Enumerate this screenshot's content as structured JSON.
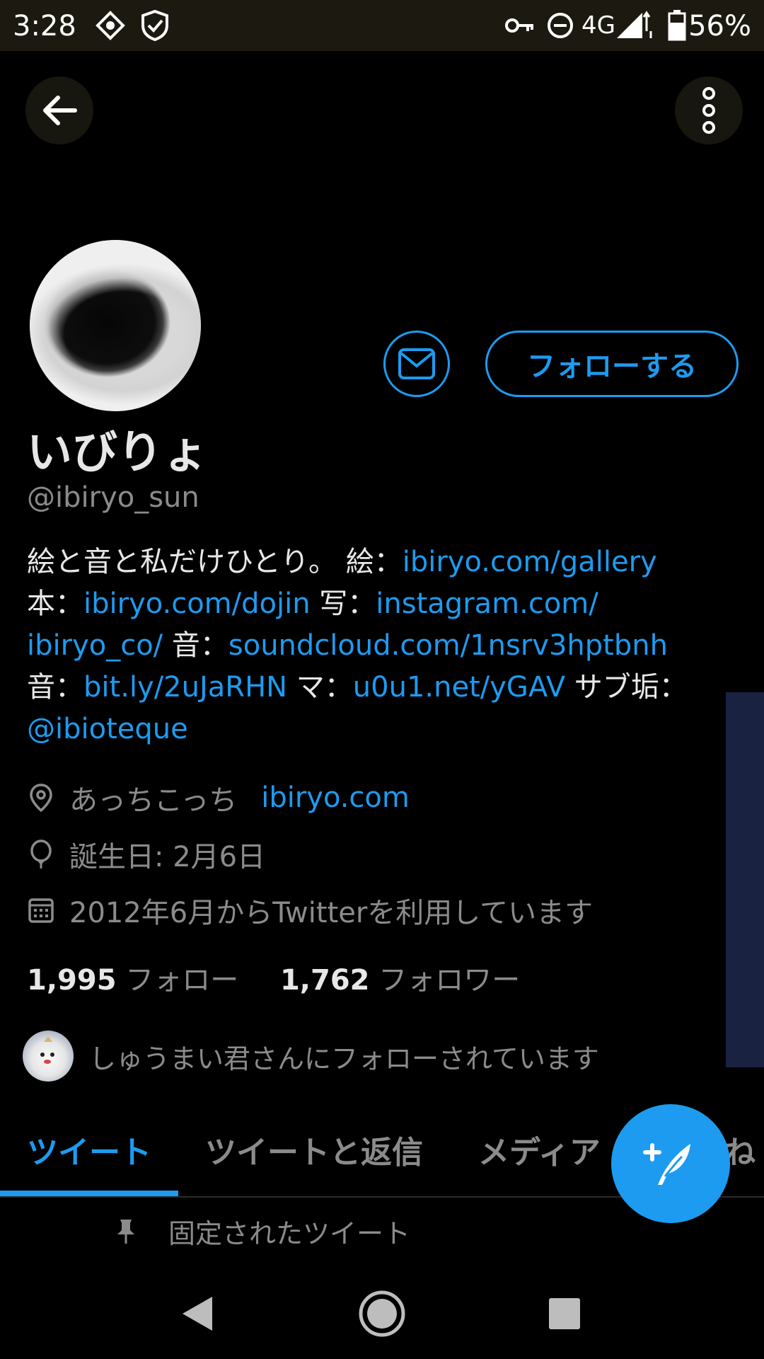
{
  "status_bar": {
    "time": "3:28",
    "network": "4G",
    "battery": "56%",
    "icons": [
      "location-diamond-icon",
      "shield-check-icon",
      "key-icon",
      "do-not-disturb-icon",
      "signal-icon",
      "battery-icon"
    ]
  },
  "header": {
    "back_icon": "arrow-left-icon",
    "menu_icon": "more-vertical-icon"
  },
  "profile": {
    "name": "いびりょ",
    "handle": "@ibiryo_sun",
    "follow_label": "フォローする",
    "dm_icon": "mail-icon"
  },
  "bio": {
    "line1_text": "絵と音と私だけひとり。 絵：",
    "line1_link": "ibiryo.com/gallery",
    "line2_prefix": "本：",
    "line2_link": "ibiryo.com/dojin",
    "line2_mid": " 写：",
    "line2_link2": "instagram.com/",
    "line3_link": "ibiryo_co/",
    "line3_mid": " 音：",
    "line3_link2": "soundcloud.com/1nsrv3hptbnh",
    "line4_prefix": "音：",
    "line4_link": "bit.ly/2uJaRHN",
    "line4_mid": " マ：",
    "line4_link2": "u0u1.net/yGAV",
    "line4_suffix": " サブ垢：",
    "line5_link": "@ibioteque"
  },
  "meta": {
    "location": "あっちこっち",
    "website": "ibiryo.com",
    "birthday": "誕生日: 2月6日",
    "joined": "2012年6月からTwitterを利用しています"
  },
  "counts": {
    "following_count": "1,995",
    "following_label": "フォロー",
    "followers_count": "1,762",
    "followers_label": "フォロワー"
  },
  "followed_by": "しゅうまい君さんにフォローされています",
  "tabs": [
    {
      "label": "ツイート",
      "active": true
    },
    {
      "label": "ツイートと返信",
      "active": false
    },
    {
      "label": "メディア",
      "active": false
    },
    {
      "label": "ね",
      "active": false
    }
  ],
  "pinned_label": "固定されたツイート",
  "fab_icon": "compose-tweet-icon",
  "accent_color": "#1d9bf0"
}
